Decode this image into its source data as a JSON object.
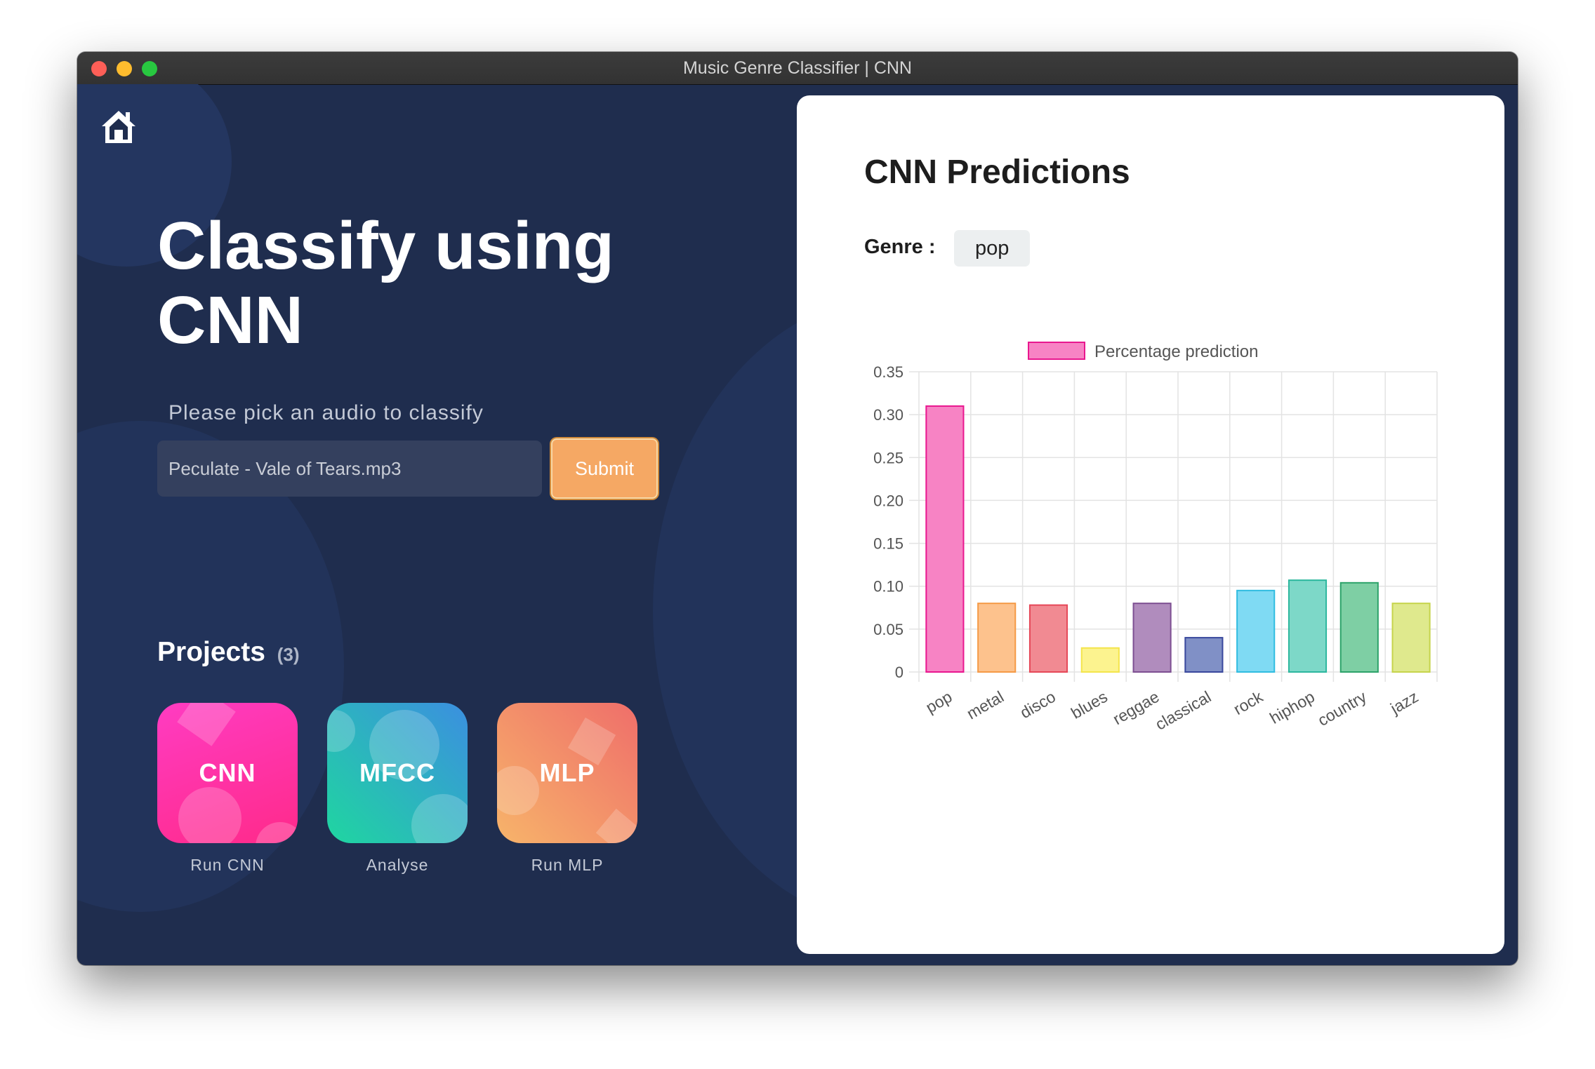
{
  "window": {
    "title": "Music Genre Classifier | CNN"
  },
  "sidebar": {
    "home_icon": "home-icon",
    "headline": "Classify using CNN",
    "pick_label": "Please pick an audio to classify",
    "file_value": "Peculate - Vale of Tears.mp3",
    "submit_label": "Submit",
    "projects_title": "Projects",
    "projects_count": "(3)",
    "projects": [
      {
        "label": "CNN",
        "caption": "Run CNN"
      },
      {
        "label": "MFCC",
        "caption": "Analyse"
      },
      {
        "label": "MLP",
        "caption": "Run MLP"
      }
    ]
  },
  "results": {
    "title": "CNN Predictions",
    "genre_label": "Genre :",
    "genre_value": "pop"
  },
  "colors": {
    "background": "#1f2d4e",
    "accent": "#f5a864"
  },
  "chart_data": {
    "type": "bar",
    "categories": [
      "pop",
      "metal",
      "disco",
      "blues",
      "reggae",
      "classical",
      "rock",
      "hiphop",
      "country",
      "jazz"
    ],
    "series": [
      {
        "name": "Percentage prediction",
        "values": [
          0.31,
          0.08,
          0.078,
          0.028,
          0.08,
          0.04,
          0.095,
          0.107,
          0.104,
          0.08
        ]
      }
    ],
    "fill_colors": [
      "#f783c4",
      "#fdc28d",
      "#f18a92",
      "#fcf38f",
      "#b08cbd",
      "#8090c6",
      "#7fdaf3",
      "#7dd8c8",
      "#7ecfa4",
      "#dfe98d"
    ],
    "border_colors": [
      "#e9178f",
      "#f59a46",
      "#e64858",
      "#f4e54c",
      "#7d4f92",
      "#39489d",
      "#30bce0",
      "#2cb79e",
      "#2da36a",
      "#c6d44c"
    ],
    "yticks": [
      "0.35",
      "0.30",
      "0.25",
      "0.20",
      "0.15",
      "0.10",
      "0.05",
      "0"
    ],
    "ylim": [
      0,
      0.35
    ],
    "grid": true,
    "legend": "top"
  }
}
